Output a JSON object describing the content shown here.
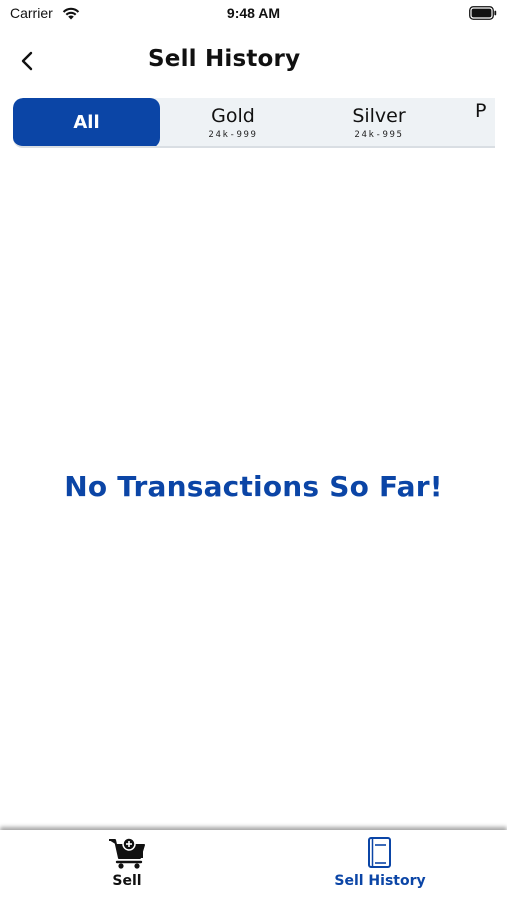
{
  "status_bar": {
    "carrier": "Carrier",
    "time": "9:48 AM"
  },
  "header": {
    "title": "Sell History",
    "back_icon": "chevron-left-icon"
  },
  "tabs": [
    {
      "label": "All",
      "sub": "",
      "active": true
    },
    {
      "label": "Gold",
      "sub": "24k-999",
      "active": false
    },
    {
      "label": "Silver",
      "sub": "24k-995",
      "active": false
    },
    {
      "label": "P",
      "sub": "",
      "active": false
    }
  ],
  "empty_state": {
    "message": "No Transactions So Far!"
  },
  "bottom_nav": {
    "items": [
      {
        "label": "Sell",
        "icon": "cart-icon",
        "active": false
      },
      {
        "label": "Sell History",
        "icon": "history-book-icon",
        "active": true
      }
    ]
  },
  "colors": {
    "accent": "#0b45a6",
    "tab_bg": "#eef2f5"
  }
}
